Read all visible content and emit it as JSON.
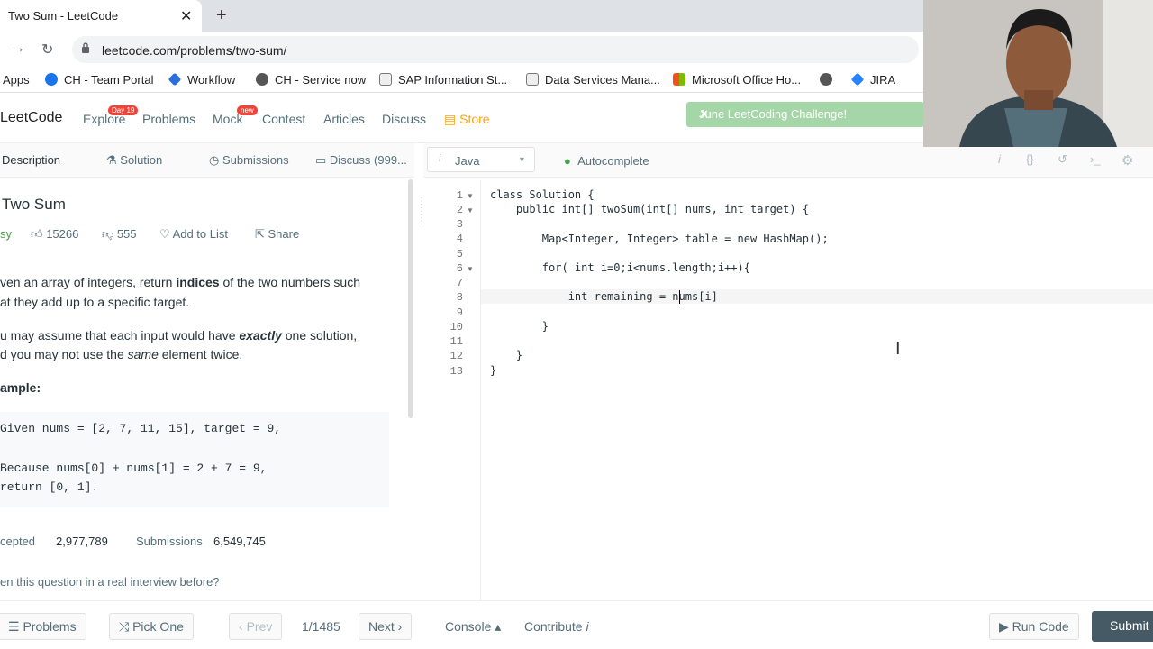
{
  "browser": {
    "tab_title": "Two Sum - LeetCode",
    "url": "leetcode.com/problems/two-sum/",
    "bookmarks": [
      "Apps",
      "CH - Team Portal",
      "Workflow",
      "CH - Service now",
      "SAP Information St...",
      "Data Services Mana...",
      "Microsoft Office Ho...",
      "JIRA"
    ]
  },
  "nav": {
    "logo": "LeetCode",
    "items": [
      "Explore",
      "Problems",
      "Mock",
      "Contest",
      "Articles",
      "Discuss",
      "Store"
    ],
    "explore_badge": "Day 19",
    "mock_badge": "new",
    "challenge": "June LeetCoding Challenge!"
  },
  "left": {
    "tabs": [
      "Description",
      "Solution",
      "Submissions",
      "Discuss (999..."
    ],
    "title": "Two Sum",
    "difficulty": "sy",
    "likes": "15266",
    "dislikes": "555",
    "add_to_list": "Add to List",
    "share": "Share",
    "desc1_a": "ven an array of integers, return ",
    "desc1_b": "indices",
    "desc1_c": " of the two numbers such",
    "desc2": "at they add up to a specific target.",
    "desc3_a": "u may assume that each input would have ",
    "desc3_b": "exactly",
    "desc3_c": " one solution,",
    "desc4_a": "d you may not use the ",
    "desc4_b": "same",
    "desc4_c": " element twice.",
    "example_label": "ample:",
    "ex1": "Given nums = [2, 7, 11, 15], target = 9,",
    "ex2": "Because nums[0] + nums[1] = 2 + 7 = 9,",
    "ex3": "return [0, 1].",
    "accepted_label": "cepted",
    "accepted": "2,977,789",
    "submissions_label": "Submissions",
    "submissions": "6,549,745",
    "interview": "en this question in a real interview before?"
  },
  "editor": {
    "language": "Java",
    "autocomplete": "Autocomplete",
    "lines": [
      "class Solution {",
      "    public int[] twoSum(int[] nums, int target) {",
      "",
      "        Map<Integer, Integer> table = new HashMap();",
      "",
      "        for( int i=0;i<nums.length;i++){",
      "",
      "            int remaining = nums[i]",
      "",
      "        }",
      "",
      "    }",
      "}"
    ],
    "line_numbers": [
      "1",
      "2",
      "3",
      "4",
      "5",
      "6",
      "7",
      "8",
      "9",
      "10",
      "11",
      "12",
      "13"
    ]
  },
  "bottom": {
    "problems": "Problems",
    "pick_one": "Pick One",
    "prev": "Prev",
    "page": "1/1485",
    "next": "Next",
    "console": "Console",
    "contribute": "Contribute",
    "run_code": "Run Code",
    "submit": "Submit"
  }
}
